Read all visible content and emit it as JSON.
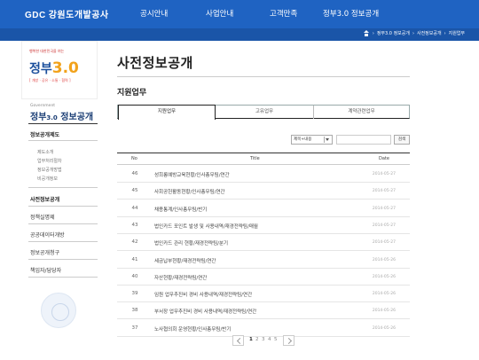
{
  "header": {
    "logo_en": "GDC",
    "logo_ko": "강원도개발공사",
    "nav": [
      "공시안내",
      "사업안내",
      "고객만족",
      "정부3.0 정보공개"
    ]
  },
  "breadcrumb": [
    "정부3.0 정보공개",
    "사전정보공개",
    "지원업무"
  ],
  "sidebar": {
    "promo_small": "행복한 대한민국을 여는",
    "promo_big": "정부",
    "promo_num": "3.0",
    "promo_tags": "[ 개방 · 공유 · 소통 · 협력 ]",
    "title_small": "Government",
    "title_a": "정부",
    "title_v": "3.0",
    "title_b": "정보공개",
    "menu": [
      {
        "label": "정보공개제도",
        "subs": [
          "제도소개",
          "업무처리절차",
          "정보공개방법",
          "비공개정보"
        ]
      },
      {
        "label": "사전정보공개"
      },
      {
        "label": "정책실명제"
      },
      {
        "label": "공공데이터개방"
      },
      {
        "label": "정보공개청구"
      },
      {
        "label": "책임자/담당자"
      }
    ]
  },
  "main": {
    "page_title": "사전정보공개",
    "section_title": "지원업무",
    "tabs": [
      "지원업무",
      "고유업무",
      "계약관련업무"
    ],
    "search": {
      "select_value": "제목+내용",
      "button": "검색"
    },
    "columns": {
      "no": "No",
      "title": "Title",
      "date": "Date"
    },
    "rows": [
      {
        "no": "46",
        "title": "성희롱예방교육현황/인사총무팀/연간",
        "date": "2014-05-27"
      },
      {
        "no": "45",
        "title": "사회공헌활동현황/인사총무팀/연간",
        "date": "2014-05-27"
      },
      {
        "no": "44",
        "title": "채용통계/인사총무팀/반기",
        "date": "2014-05-27"
      },
      {
        "no": "43",
        "title": "법인카드 포인트 발생 및 사용내역/재경전략팀/매월",
        "date": "2014-05-27"
      },
      {
        "no": "42",
        "title": "법인카드 관리 현황/재경전략팀/분기",
        "date": "2014-05-27"
      },
      {
        "no": "41",
        "title": "세금납부현황/재경전략팀/연간",
        "date": "2014-05-26"
      },
      {
        "no": "40",
        "title": "자산현황/재경전략팀/연간",
        "date": "2014-05-26"
      },
      {
        "no": "39",
        "title": "임원 업무추진비 경비 사용내역/재경전략팀/연간",
        "date": "2014-05-26"
      },
      {
        "no": "38",
        "title": "부서장 업무추진비 경비 사용내역/재경전략팀/연간",
        "date": "2014-05-26"
      },
      {
        "no": "37",
        "title": "노사협의회 운영현황/인사총무팀/반기",
        "date": "2014-05-26"
      }
    ],
    "pages": [
      "1",
      "2",
      "3",
      "4",
      "5"
    ]
  }
}
